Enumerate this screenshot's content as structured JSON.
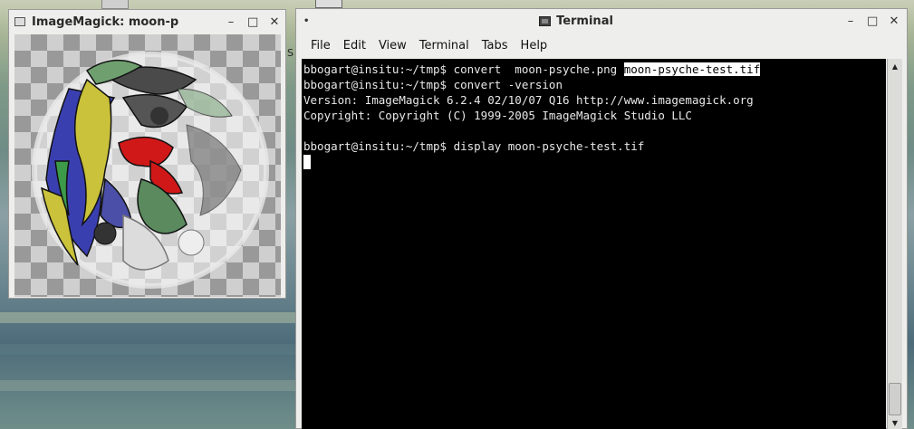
{
  "imagemagick": {
    "title": "ImageMagick: moon-p",
    "wm_buttons": [
      "–",
      "□",
      "✕"
    ]
  },
  "terminal": {
    "title": "Terminal",
    "wm_buttons": [
      "–",
      "□",
      "✕"
    ],
    "menu": [
      "File",
      "Edit",
      "View",
      "Terminal",
      "Tabs",
      "Help"
    ],
    "lines": [
      {
        "prefix": "bbogart@insitu:~/tmp$ convert  moon-psyche.png ",
        "highlight": "moon-psyche-test.tif"
      },
      {
        "prefix": "bbogart@insitu:~/tmp$ convert -version",
        "highlight": ""
      },
      {
        "prefix": "Version: ImageMagick 6.2.4 02/10/07 Q16 http://www.imagemagick.org",
        "highlight": ""
      },
      {
        "prefix": "Copyright: Copyright (C) 1999-2005 ImageMagick Studio LLC",
        "highlight": ""
      },
      {
        "prefix": "",
        "highlight": ""
      },
      {
        "prefix": "bbogart@insitu:~/tmp$ display moon-psyche-test.tif",
        "highlight": ""
      }
    ]
  },
  "desktop": {
    "side_label": "S"
  },
  "colors": {
    "window_bg": "#eeeeec",
    "terminal_bg": "#000000",
    "terminal_fg": "#e8e8e8"
  }
}
